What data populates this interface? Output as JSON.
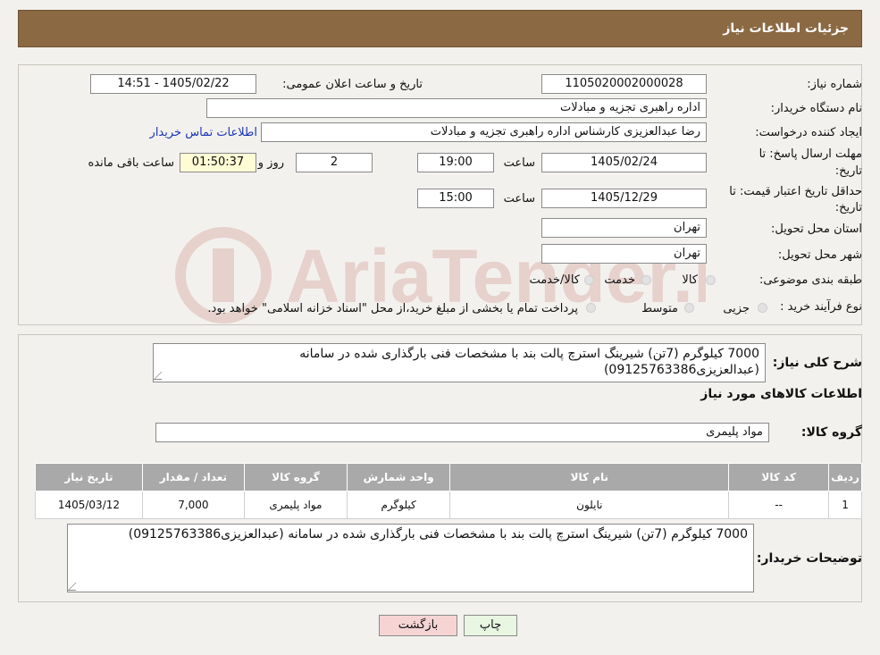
{
  "header": {
    "title": "جزئیات اطلاعات نیاز"
  },
  "form": {
    "need_number_label": "شماره نیاز:",
    "need_number": "1105020002000028",
    "announce_label": "تاریخ و ساعت اعلان عمومی:",
    "announce_value": "1405/02/22 - 14:51",
    "buyer_org_label": "نام دستگاه خریدار:",
    "buyer_org": "اداره راهبری تجزیه و مبادلات",
    "requester_label": "ایجاد کننده درخواست:",
    "requester": "رضا عبدالعزیزی کارشناس اداره راهبری تجزیه و مبادلات",
    "contact_link": "اطلاعات تماس خریدار",
    "deadline_label_1": "مهلت ارسال پاسخ: تا",
    "deadline_label_2": "تاریخ:",
    "deadline_date": "1405/02/24",
    "time_label": "ساعت",
    "deadline_time": "19:00",
    "days_value": "2",
    "days_label": "روز و",
    "remaining_time": "01:50:37",
    "remaining_label": "ساعت باقی مانده",
    "price_valid_label_1": "حداقل تاریخ اعتبار قیمت: تا",
    "price_valid_label_2": "تاریخ:",
    "price_valid_date": "1405/12/29",
    "price_valid_time": "15:00",
    "province_label": "استان محل تحویل:",
    "province": "تهران",
    "city_label": "شهر محل تحویل:",
    "city": "تهران",
    "category_label": "طبقه بندی موضوعی:",
    "category_options": [
      "کالا",
      "خدمت",
      "کالا/خدمت"
    ],
    "process_label": "نوع فرآیند خرید :",
    "process_options": [
      "جزیی",
      "متوسط"
    ],
    "process_note": "پرداخت تمام یا بخشی از مبلغ خرید،از محل \"اسناد خزانه اسلامی\" خواهد بود."
  },
  "summary": {
    "label": "شرح کلی نیاز:",
    "text": "7000 کیلوگرم (7تن) شیرینگ استرچ پالت بند با مشخصات فنی بارگذاری شده در سامانه (عبدالعزیزی09125763386)"
  },
  "goods": {
    "section_title": "اطلاعات کالاهای مورد نیاز",
    "group_label": "گروه کالا:",
    "group_value": "مواد پلیمری",
    "table_headers": [
      "ردیف",
      "کد کالا",
      "نام کالا",
      "واحد شمارش",
      "گروه کالا",
      "تعداد / مقدار",
      "تاریخ نیاز"
    ],
    "rows": [
      [
        "1",
        "--",
        "نایلون",
        "کیلوگرم",
        "مواد پلیمری",
        "7,000",
        "1405/03/12"
      ]
    ]
  },
  "buyer_notes": {
    "label": "توضیحات خریدار:",
    "text": "7000 کیلوگرم (7تن) شیرینگ استرچ پالت بند با مشخصات فنی بارگذاری شده در سامانه (عبدالعزیزی09125763386)"
  },
  "buttons": {
    "print": "چاپ",
    "back": "بازگشت"
  },
  "colors": {
    "header": "#8b6a43",
    "back_button": "#f6d4d4",
    "print_button": "#e8f6e2",
    "link": "#1a35b8"
  }
}
